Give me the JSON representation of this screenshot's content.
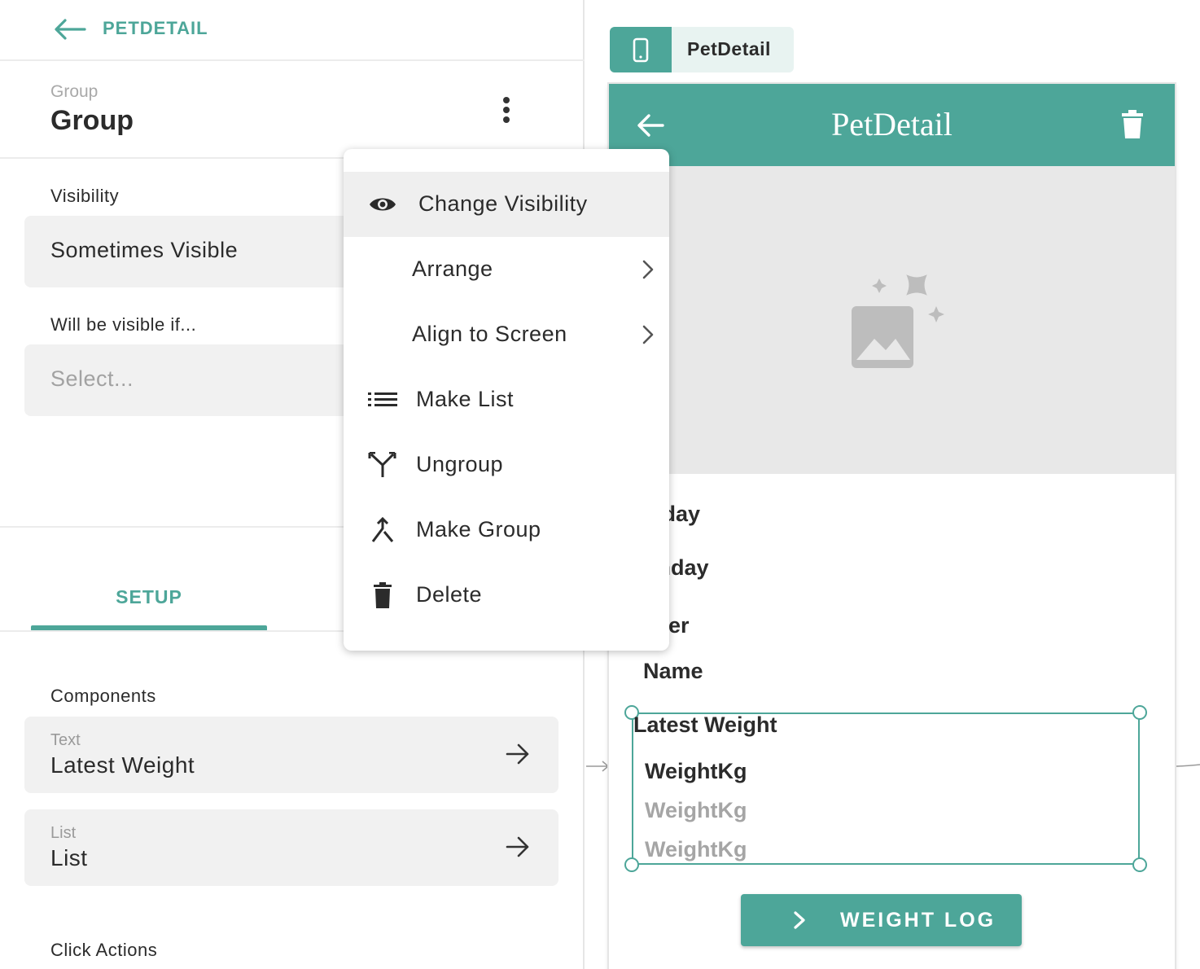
{
  "left_panel": {
    "back_label": "PETDETAIL",
    "group_caption": "Group",
    "group_title": "Group",
    "visibility_label": "Visibility",
    "visibility_value": "Sometimes Visible",
    "condition_label": "Will be visible if...",
    "condition_placeholder": "Select...",
    "tab_label": "SETUP",
    "components_label": "Components",
    "components": [
      {
        "type": "Text",
        "name": "Latest Weight"
      },
      {
        "type": "List",
        "name": "List"
      }
    ],
    "click_actions_label": "Click Actions"
  },
  "context_menu": {
    "items": [
      {
        "label": "Change Visibility",
        "icon": "eye-icon"
      },
      {
        "label": "Arrange",
        "icon": "chevron-right-icon"
      },
      {
        "label": "Align to Screen",
        "icon": "chevron-right-icon"
      },
      {
        "label": "Make List",
        "icon": "list-icon"
      },
      {
        "label": "Ungroup",
        "icon": "ungroup-icon"
      },
      {
        "label": "Make Group",
        "icon": "merge-icon"
      },
      {
        "label": "Delete",
        "icon": "trash-icon"
      }
    ]
  },
  "preview": {
    "screen_chip_label": "PetDetail",
    "appbar_title": "PetDetail",
    "fields_visible": [
      "thday",
      "rthday",
      "nder",
      "Name"
    ],
    "group_title": "Latest Weight",
    "list_items": [
      "WeightKg",
      "WeightKg",
      "WeightKg"
    ],
    "button_label": "WEIGHT LOG"
  },
  "colors": {
    "accent": "#4da699",
    "text": "#2b2b2b",
    "muted": "#a9a9a9",
    "field_bg": "#f1f1f1",
    "image_placeholder_bg": "#e8e8e8"
  }
}
